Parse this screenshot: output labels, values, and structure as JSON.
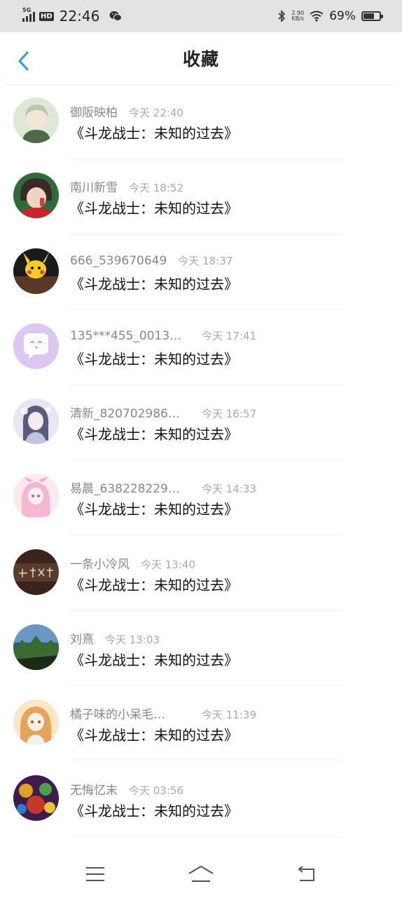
{
  "status_bar": {
    "network": "5G",
    "hd": "HD",
    "time": "22:46",
    "speed_value": "2.90",
    "speed_unit": "KB/s",
    "battery_percent_text": "69%",
    "battery_level": 0.69
  },
  "header": {
    "title": "收藏",
    "back_icon": "chevron-left-icon",
    "accent_color": "#2e9bdf"
  },
  "favorites": [
    {
      "username": "御阪映柏",
      "time": "今天 22:40",
      "title": "《斗龙战士：未知的过去》",
      "avatar_icon": "avatar-anime-boy"
    },
    {
      "username": "南川新雪",
      "time": "今天 18:52",
      "title": "《斗龙战士：未知的过去》",
      "avatar_icon": "avatar-child-photo"
    },
    {
      "username": "666_539670649",
      "time": "今天 18:37",
      "title": "《斗龙战士：未知的过去》",
      "avatar_icon": "avatar-pikachu"
    },
    {
      "username": "135***455_0013…",
      "time": "今天 17:41",
      "title": "《斗龙战士：未知的过去》",
      "avatar_icon": "avatar-chat-bubble-default"
    },
    {
      "username": "清新_820702986…",
      "time": "今天 16:57",
      "title": "《斗龙战士：未知的过去》",
      "avatar_icon": "avatar-anime-girl-lace"
    },
    {
      "username": "易晨_638228229…",
      "time": "今天 14:33",
      "title": "《斗龙战士：未知的过去》",
      "avatar_icon": "avatar-anime-girl-pink"
    },
    {
      "username": "一条小冷风",
      "time": "今天 13:40",
      "title": "《斗龙战士：未知的过去》",
      "avatar_icon": "avatar-calligraphy-brown"
    },
    {
      "username": "刘熹",
      "time": "今天 13:03",
      "title": "《斗龙战士：未知的过去》",
      "avatar_icon": "avatar-landscape"
    },
    {
      "username": "橘子味的小呆毛…",
      "time": "今天 11:39",
      "title": "《斗龙战士：未知的过去》",
      "avatar_icon": "avatar-anime-girl-orange"
    },
    {
      "username": "无悔忆末",
      "time": "今天 03:56",
      "title": "《斗龙战士：未知的过去》",
      "avatar_icon": "avatar-game-art"
    }
  ],
  "nav": {
    "menu_icon": "menu-icon",
    "home_icon": "home-icon",
    "back_icon": "back-arrow-icon"
  }
}
